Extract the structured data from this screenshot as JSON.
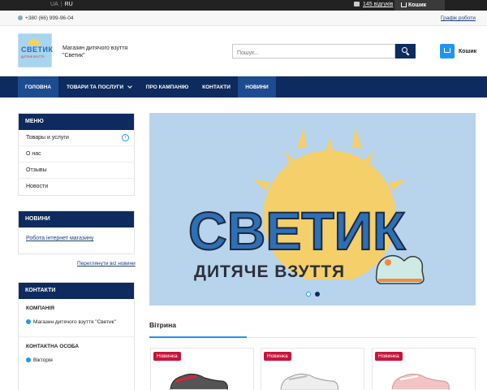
{
  "topbar": {
    "lang_ua": "UA",
    "lang_ru": "RU",
    "reviews": "145 відгуків",
    "cart": "Кошик"
  },
  "phonebar": {
    "phone": "+380 (66) 999-96-04",
    "schedule": "Графік роботи"
  },
  "header": {
    "logo_text": "СВЕТИК",
    "logo_subtext": "ДИТЯЧЕ ВЗУТТЯ",
    "shop_name": "Магазин дитячого взуття \"Светик\"",
    "search_placeholder": "Пошук...",
    "cart_label": "Кошик"
  },
  "nav": {
    "items": [
      {
        "label": "ГОЛОВНА"
      },
      {
        "label": "ТОВАРИ ТА ПОСЛУГИ"
      },
      {
        "label": "ПРО КАМПАНІЮ"
      },
      {
        "label": "КОНТАКТИ"
      },
      {
        "label": "НОВИНИ"
      }
    ]
  },
  "sidebar": {
    "menu_title": "МЕНЮ",
    "menu_items": [
      {
        "label": "Товары и услуги"
      },
      {
        "label": "О нас"
      },
      {
        "label": "Отзывы"
      },
      {
        "label": "Новости"
      }
    ],
    "news_title": "НОВИНИ",
    "news_link": "Робота інтернет магазину",
    "all_news": "Переглянути всі новини",
    "contacts_title": "КОНТАКТИ",
    "company_title": "КОМПАНІЯ",
    "company_name": "Магазин дитячого взуття \"Светик\"",
    "person_title": "КОНТАКТНА ОСОБА",
    "person_name": "Вікторія"
  },
  "banner": {
    "title": "СВЕТИК",
    "subtitle": "ДИТЯЧЕ ВЗУТТЯ",
    "slides": 2,
    "active_slide": 2
  },
  "showcase": {
    "title": "Вітрина",
    "cards": [
      {
        "badge": "Новинка"
      },
      {
        "badge": "Новинка"
      },
      {
        "badge": "Новинка"
      }
    ]
  },
  "colors": {
    "navy": "#0d2b5e",
    "accent_blue": "#2196f3",
    "badge_red": "#c8143c",
    "banner_bg": "#b8d3ec",
    "sun_yellow": "#f7d060"
  }
}
